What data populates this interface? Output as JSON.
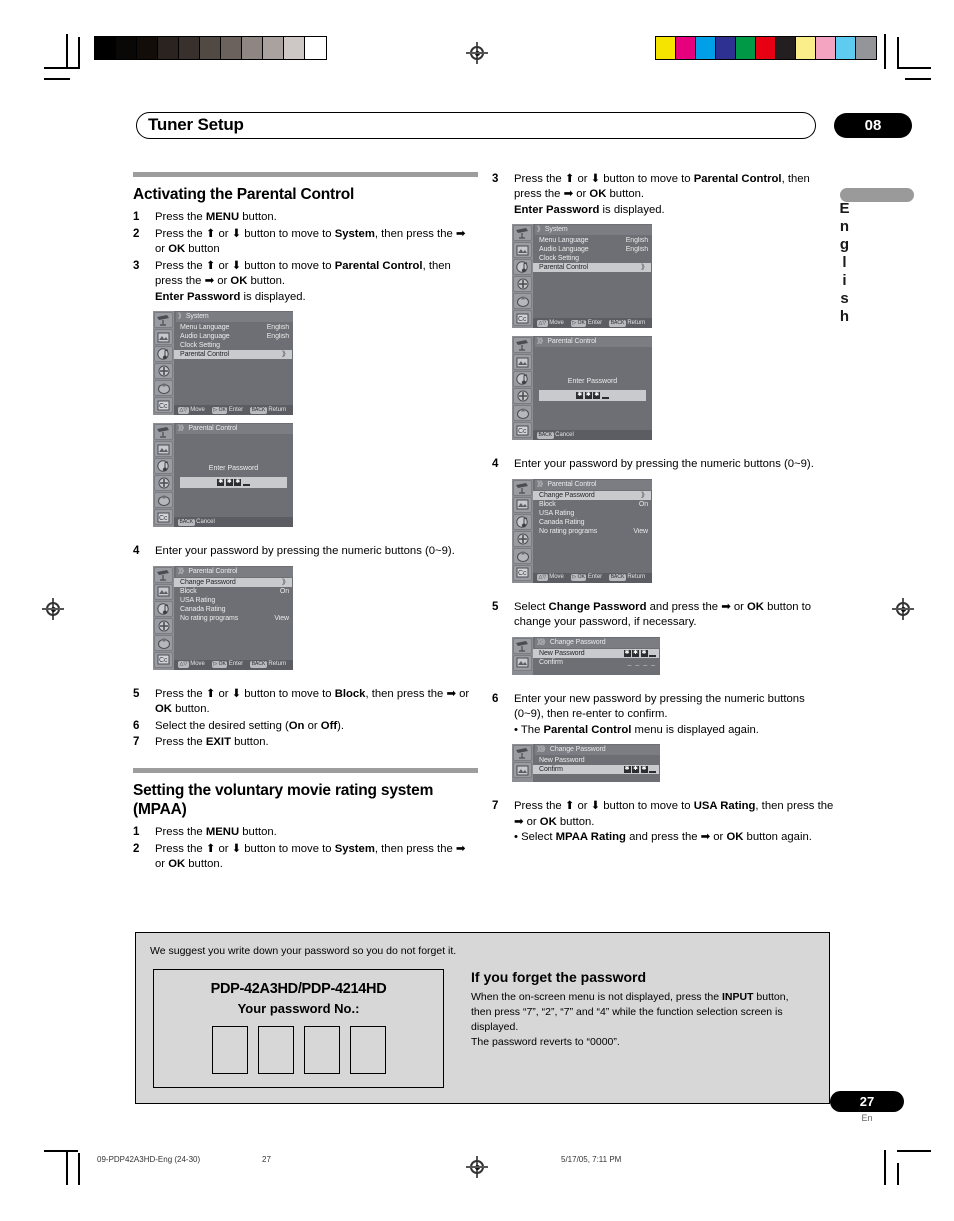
{
  "header": {
    "title": "Tuner Setup",
    "chapter": "08",
    "side_language": "English"
  },
  "left_column": {
    "section_title": "Activating the Parental Control",
    "steps": [
      {
        "num": "1",
        "text_html": "Press the <b>MENU</b> button."
      },
      {
        "num": "2",
        "text_html": "Press the ⬆ or ⬇ button to move to <b>System</b>, then press the ➡ or <b>OK</b> button"
      },
      {
        "num": "3",
        "text_html": "Press the ⬆ or ⬇ button to move to <b>Parental Control</b>, then press the ➡ or <b>OK</b> button.<br><b>Enter Password</b> is displayed."
      },
      {
        "num": "4",
        "text_html": "Enter your password by pressing the numeric buttons (0~9)."
      },
      {
        "num": "5",
        "text_html": "Press the ⬆ or ⬇ button to move to <b>Block</b>, then press the ➡ or <b>OK</b> button."
      },
      {
        "num": "6",
        "text_html": "Select the desired setting (<b>On</b> or <b>Off</b>)."
      },
      {
        "num": "7",
        "text_html": "Press the <b>EXIT</b> button."
      }
    ],
    "section2_title": "Setting the voluntary movie rating system (MPAA)",
    "steps2": [
      {
        "num": "1",
        "text_html": "Press the <b>MENU</b> button."
      },
      {
        "num": "2",
        "text_html": "Press the ⬆ or ⬇ button to move to <b>System</b>, then press the ➡ or <b>OK</b> button."
      }
    ]
  },
  "right_column": {
    "steps": [
      {
        "num": "3",
        "text_html": "Press the ⬆ or ⬇ button to move to <b>Parental Control</b>, then press the ➡ or <b>OK</b> button.<br><b>Enter Password</b> is displayed."
      },
      {
        "num": "4",
        "text_html": "Enter your password by pressing the numeric buttons (0~9)."
      },
      {
        "num": "5",
        "text_html": "Select <b>Change Password</b> and press the ➡ or <b>OK</b> button to change your password, if necessary."
      },
      {
        "num": "6",
        "text_html": "Enter your new password by pressing the numeric buttons (0~9), then re-enter to confirm."
      },
      {
        "num": "7",
        "text_html": "Press the ⬆ or ⬇ button to move to <b>USA Rating</b>, then press the ➡ or <b>OK</b> button."
      }
    ],
    "bullet_6": "• The <b>Parental Control</b> menu is displayed again.",
    "bullet_7": "• Select <b>MPAA Rating</b> and press the ➡ or <b>OK</b> button again."
  },
  "osd": {
    "system_menu": {
      "title": "System",
      "chevrons": "》",
      "rows": [
        {
          "label": "Menu Language",
          "value": "English",
          "selected": false
        },
        {
          "label": "Audio Language",
          "value": "English",
          "selected": false
        },
        {
          "label": "Clock Setting",
          "value": "",
          "selected": false
        },
        {
          "label": "Parental Control",
          "value": "》",
          "selected": true
        }
      ],
      "footer": [
        {
          "keys": "△▽",
          "label": "Move"
        },
        {
          "keys": "▷ OK",
          "label": "Enter"
        },
        {
          "keys": "BACK",
          "label": "Return"
        }
      ]
    },
    "enter_password": {
      "title": "Parental Control",
      "chevrons": "》》",
      "center_label": "Enter Password",
      "password_stars": 3,
      "footer": [
        {
          "keys": "BACK",
          "label": "Cancel"
        }
      ]
    },
    "parental_control_menu": {
      "title": "Parental Control",
      "chevrons": "》》",
      "rows": [
        {
          "label": "Change Password",
          "value": "》",
          "selected": true
        },
        {
          "label": "Block",
          "value": "On",
          "selected": false
        },
        {
          "label": "USA Rating",
          "value": "",
          "selected": false
        },
        {
          "label": "Canada Rating",
          "value": "",
          "selected": false
        },
        {
          "label": "No rating programs",
          "value": "View",
          "selected": false
        }
      ],
      "footer": [
        {
          "keys": "△▽",
          "label": "Move"
        },
        {
          "keys": "▷ OK",
          "label": "Enter"
        },
        {
          "keys": "BACK",
          "label": "Return"
        }
      ]
    },
    "change_password_new": {
      "title": "Change Password",
      "chevrons": "》》》",
      "rows": [
        {
          "label": "New Password",
          "value": "stars",
          "selected": true
        },
        {
          "label": "Confirm",
          "value": "dashes",
          "selected": false
        }
      ]
    },
    "change_password_confirm": {
      "title": "Change Password",
      "chevrons": "》》》",
      "rows": [
        {
          "label": "New Password",
          "value": "",
          "selected": false
        },
        {
          "label": "Confirm",
          "value": "stars",
          "selected": true
        }
      ]
    },
    "icons": [
      "antenna-icon",
      "picture-icon",
      "sound-icon",
      "option-icon",
      "power-icon",
      "closed-caption-icon"
    ]
  },
  "note_box": {
    "top_text": "We suggest you write down your password so you do not forget it.",
    "model": "PDP-42A3HD/PDP-4214HD",
    "password_label": "Your password No.:",
    "digit_count": 4,
    "forget_heading": "If you forget the password",
    "forget_body_html": "When the on-screen menu is not displayed, press the <b>INPUT</b> button, then press “7”, “2”, “7” and “4” while the function selection screen is displayed.<br>The password reverts to “0000”."
  },
  "footer": {
    "page_number": "27",
    "page_lang": "En",
    "print_file": "09-PDP42A3HD-Eng (24-30)",
    "print_page": "27",
    "print_date": "5/17/05, 7:11 PM"
  },
  "print_marks": {
    "gray_bars": [
      "#000000",
      "#0a0807",
      "#120d09",
      "#2a2320",
      "#37302c",
      "#514944",
      "#6b625d",
      "#8d8682",
      "#a9a29e",
      "#cdc8c5",
      "#ffffff"
    ],
    "color_bars": [
      "#f5e400",
      "#e6007e",
      "#00a0e9",
      "#2e3192",
      "#009945",
      "#e60012",
      "#231f20",
      "#faee8a",
      "#f4a3c1",
      "#5ecbf1",
      "#939598"
    ]
  }
}
